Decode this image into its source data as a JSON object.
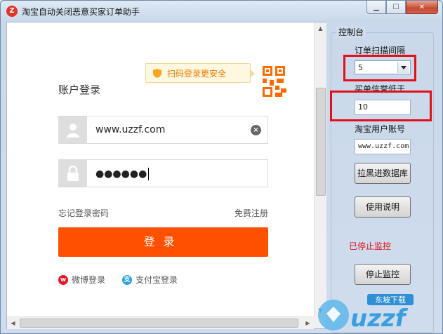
{
  "window": {
    "title": "淘宝自动关闭恶意买家订单助手",
    "app_icon_letter": "Z",
    "buttons": {
      "minimize": "▁",
      "maximize": "☐",
      "close": "✕"
    }
  },
  "login": {
    "qr_tip": "扫码登录更安全",
    "title": "账户登录",
    "username": "www.uzzf.com",
    "password_mask": "●●●●●●",
    "forgot_password": "忘记登录密码",
    "register": "免费注册",
    "login_button": "登录",
    "weibo_login": "微博登录",
    "alipay_login": "支付宝登录"
  },
  "control_panel": {
    "legend": "控制台",
    "scan_interval_label": "订单扫描间隔",
    "scan_interval_value": "5",
    "credit_threshold_label": "买单信誉低于",
    "credit_threshold_value": "10",
    "taobao_account_label": "淘宝用户账号",
    "taobao_account_value": "www.uzzf.com",
    "blacklist_button": "拉黑进数据库",
    "help_button": "使用说明",
    "status_text": "已停止监控",
    "stop_button": "停止监控"
  },
  "watermark": {
    "text": "uzzf",
    "sub": "东坡下载"
  },
  "colors": {
    "accent": "#ff5000",
    "tip_text": "#f07c00",
    "status": "#e0101a",
    "highlight": "#e3101a"
  }
}
